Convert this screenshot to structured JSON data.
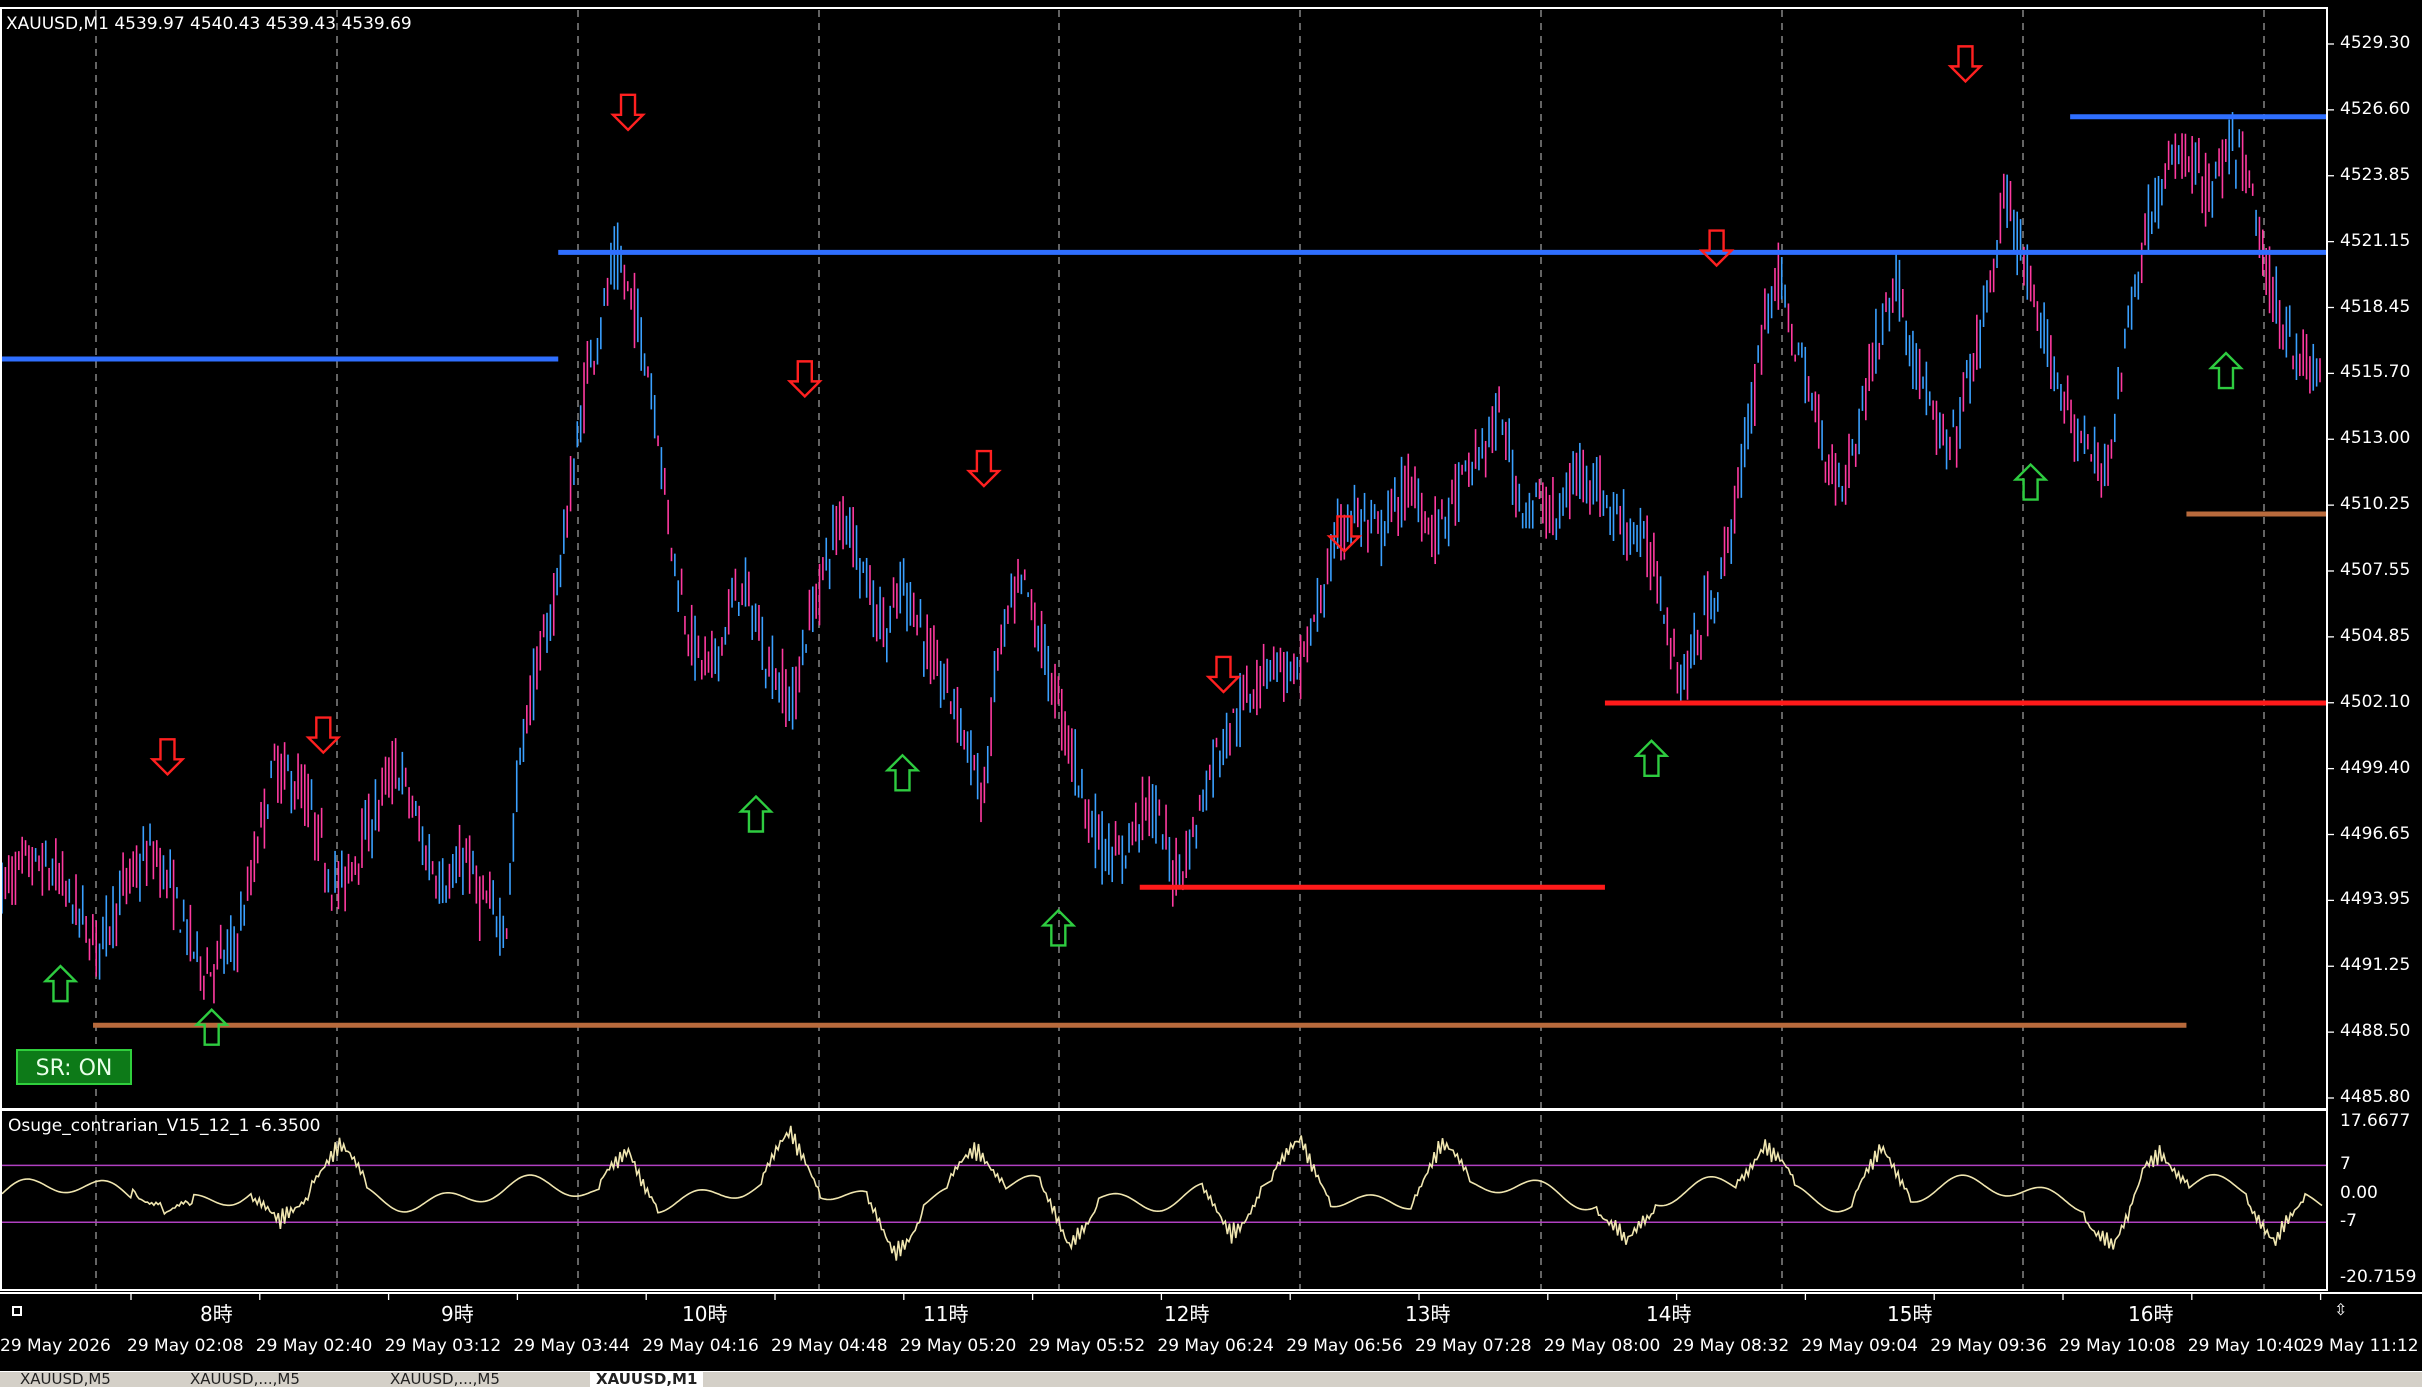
{
  "symbol_info": "XAUUSD,M1  4539.97 4540.43 4539.43 4539.69",
  "indicator_info": "Osuge_contrarian_V15_12_1 -6.3500",
  "sr_button": "SR: ON",
  "price_axis": {
    "ticks": [
      "4529.30",
      "4526.60",
      "4523.85",
      "4521.15",
      "4518.45",
      "4515.70",
      "4513.00",
      "4510.25",
      "4507.55",
      "4504.85",
      "4502.10",
      "4499.40",
      "4496.65",
      "4493.95",
      "4491.25",
      "4488.50",
      "4485.80"
    ],
    "min": 4485.8,
    "max": 4529.3
  },
  "indicator_axis": {
    "ticks": [
      "17.6677",
      "7",
      "0.00",
      "-7",
      "-20.7159"
    ],
    "levels": [
      7,
      -7
    ],
    "min": -20.7159,
    "max": 17.6677
  },
  "timeframe_labels": [
    "8時",
    "9時",
    "10時",
    "11時",
    "12時",
    "13時",
    "14時",
    "15時",
    "16時"
  ],
  "time_labels": [
    "29 May 2026",
    "29 May 02:08",
    "29 May 02:40",
    "29 May 03:12",
    "29 May 03:44",
    "29 May 04:16",
    "29 May 04:48",
    "29 May 05:20",
    "29 May 05:52",
    "29 May 06:24",
    "29 May 06:56",
    "29 May 07:28",
    "29 May 08:00",
    "29 May 08:32",
    "29 May 09:04",
    "29 May 09:36",
    "29 May 10:08",
    "29 May 10:40",
    "29 May 11:12"
  ],
  "tabs": [
    "XAUUSD,M5",
    "XAUUSD,...,M5",
    "XAUUSD,...,M5",
    "XAUUSD,M1"
  ],
  "colors": {
    "background": "#000000",
    "bull_candle": "#3aa0ff",
    "bear_candle": "#ff3aa0",
    "resistance_blue": "#2f6fff",
    "support_red": "#ff1a1a",
    "level_brown": "#b86a3c",
    "buy_arrow": "#2ecc40",
    "sell_arrow": "#ff2020",
    "indicator_line": "#f0e6b0",
    "indicator_level": "#b040c0"
  },
  "chart_data": {
    "type": "candlestick",
    "symbol": "XAUUSD",
    "timeframe": "M1",
    "ohlc_last": {
      "open": 4539.97,
      "high": 4540.43,
      "low": 4539.43,
      "close": 4539.69
    },
    "ylim": [
      4485.8,
      4529.3
    ],
    "price_path": [
      [
        0,
        4494.5
      ],
      [
        2,
        4495.5
      ],
      [
        4,
        4495
      ],
      [
        5,
        4494
      ],
      [
        6,
        4493
      ],
      [
        7,
        4492
      ],
      [
        9,
        4494.5
      ],
      [
        11,
        4496
      ],
      [
        12,
        4495
      ],
      [
        13,
        4493.5
      ],
      [
        14,
        4492
      ],
      [
        15,
        4491
      ],
      [
        17,
        4492
      ],
      [
        18,
        4494
      ],
      [
        19,
        4497
      ],
      [
        20,
        4499.5
      ],
      [
        21,
        4499
      ],
      [
        22,
        4498.5
      ],
      [
        23,
        4497
      ],
      [
        24,
        4495
      ],
      [
        25,
        4494.5
      ],
      [
        26,
        4496
      ],
      [
        27,
        4497
      ],
      [
        28,
        4498.5
      ],
      [
        29,
        4499.5
      ],
      [
        30,
        4498
      ],
      [
        31,
        4496
      ],
      [
        32,
        4495
      ],
      [
        33,
        4494.5
      ],
      [
        34,
        4496
      ],
      [
        35,
        4494
      ],
      [
        36,
        4493.5
      ],
      [
        37,
        4493
      ],
      [
        38,
        4500
      ],
      [
        39,
        4503
      ],
      [
        40,
        4505
      ],
      [
        41,
        4508
      ],
      [
        42,
        4512
      ],
      [
        43,
        4516
      ],
      [
        44,
        4518
      ],
      [
        45,
        4520.5
      ],
      [
        46,
        4519
      ],
      [
        47,
        4517
      ],
      [
        48,
        4514
      ],
      [
        49,
        4509
      ],
      [
        50,
        4506
      ],
      [
        51,
        4504
      ],
      [
        52,
        4503.5
      ],
      [
        53,
        4505
      ],
      [
        54,
        4507
      ],
      [
        55,
        4506
      ],
      [
        56,
        4504
      ],
      [
        57,
        4503
      ],
      [
        58,
        4502
      ],
      [
        59,
        4505
      ],
      [
        60,
        4507
      ],
      [
        61,
        4509
      ],
      [
        62,
        4510
      ],
      [
        63,
        4508
      ],
      [
        64,
        4506
      ],
      [
        65,
        4505
      ],
      [
        66,
        4507
      ],
      [
        67,
        4506
      ],
      [
        68,
        4504
      ],
      [
        69,
        4503
      ],
      [
        70,
        4502
      ],
      [
        71,
        4500
      ],
      [
        72,
        4498
      ],
      [
        73,
        4504
      ],
      [
        74,
        4506
      ],
      [
        75,
        4507
      ],
      [
        76,
        4505
      ],
      [
        77,
        4503
      ],
      [
        78,
        4501
      ],
      [
        79,
        4499
      ],
      [
        80,
        4497
      ],
      [
        81,
        4496
      ],
      [
        82,
        4495.5
      ],
      [
        83,
        4497
      ],
      [
        84,
        4498
      ],
      [
        85,
        4497
      ],
      [
        86,
        4495
      ],
      [
        87,
        4496
      ],
      [
        88,
        4498
      ],
      [
        89,
        4500
      ],
      [
        90,
        4501
      ],
      [
        91,
        4502
      ],
      [
        92,
        4503
      ],
      [
        93,
        4504
      ],
      [
        94,
        4503.5
      ],
      [
        95,
        4503
      ],
      [
        96,
        4505
      ],
      [
        97,
        4507
      ],
      [
        98,
        4509
      ],
      [
        99,
        4510
      ],
      [
        100,
        4509.5
      ],
      [
        101,
        4509
      ],
      [
        102,
        4510
      ],
      [
        103,
        4511
      ],
      [
        104,
        4510.5
      ],
      [
        105,
        4509
      ],
      [
        106,
        4510
      ],
      [
        107,
        4511
      ],
      [
        108,
        4512
      ],
      [
        109,
        4513
      ],
      [
        110,
        4514
      ],
      [
        111,
        4511
      ],
      [
        112,
        4510
      ],
      [
        113,
        4510.5
      ],
      [
        114,
        4509.5
      ],
      [
        115,
        4511
      ],
      [
        116,
        4512
      ],
      [
        117,
        4511
      ],
      [
        118,
        4510
      ],
      [
        119,
        4509.5
      ],
      [
        120,
        4509
      ],
      [
        121,
        4508
      ],
      [
        122,
        4506
      ],
      [
        123,
        4503
      ],
      [
        124,
        4504
      ],
      [
        125,
        4506
      ],
      [
        126,
        4507
      ],
      [
        127,
        4510
      ],
      [
        128,
        4513
      ],
      [
        129,
        4517
      ],
      [
        130,
        4520
      ],
      [
        131,
        4518
      ],
      [
        132,
        4516
      ],
      [
        133,
        4514
      ],
      [
        134,
        4512
      ],
      [
        135,
        4511
      ],
      [
        136,
        4513
      ],
      [
        137,
        4516
      ],
      [
        138,
        4518
      ],
      [
        139,
        4519.5
      ],
      [
        140,
        4517
      ],
      [
        141,
        4515
      ],
      [
        142,
        4513
      ],
      [
        143,
        4512.5
      ],
      [
        144,
        4515
      ],
      [
        145,
        4517
      ],
      [
        146,
        4520
      ],
      [
        147,
        4523
      ],
      [
        148,
        4521
      ],
      [
        149,
        4518
      ],
      [
        150,
        4517
      ],
      [
        151,
        4515
      ],
      [
        152,
        4513.5
      ],
      [
        153,
        4512.5
      ],
      [
        154,
        4511.5
      ],
      [
        155,
        4514
      ],
      [
        156,
        4518
      ],
      [
        157,
        4521
      ],
      [
        158,
        4523
      ],
      [
        159,
        4524
      ],
      [
        160,
        4525
      ],
      [
        161,
        4524
      ],
      [
        162,
        4523
      ],
      [
        163,
        4524.5
      ],
      [
        164,
        4525
      ],
      [
        165,
        4523
      ],
      [
        166,
        4520
      ],
      [
        167,
        4518
      ],
      [
        168,
        4517
      ],
      [
        169,
        4516
      ],
      [
        170,
        4515.5
      ]
    ],
    "horizontal_levels": [
      {
        "price": 4516.3,
        "color": "resistance_blue",
        "from": 0,
        "to": 24
      },
      {
        "price": 4520.7,
        "color": "resistance_blue",
        "from": 24,
        "to": 100
      },
      {
        "price": 4526.3,
        "color": "resistance_blue",
        "from": 89,
        "to": 100
      },
      {
        "price": 4494.5,
        "color": "support_red",
        "from": 49,
        "to": 69
      },
      {
        "price": 4502.1,
        "color": "support_red",
        "from": 69,
        "to": 100
      },
      {
        "price": 4488.8,
        "color": "level_brown",
        "from": 4,
        "to": 94
      },
      {
        "price": 4509.9,
        "color": "level_brown",
        "from": 94,
        "to": 100
      }
    ],
    "signals": [
      {
        "type": "buy",
        "x": 2.6,
        "price": 4490.5
      },
      {
        "type": "buy",
        "x": 9.1,
        "price": 4488.7
      },
      {
        "type": "buy",
        "x": 32.5,
        "price": 4497.5
      },
      {
        "type": "buy",
        "x": 38.8,
        "price": 4499.2
      },
      {
        "type": "buy",
        "x": 45.5,
        "price": 4492.8
      },
      {
        "type": "buy",
        "x": 71,
        "price": 4499.8
      },
      {
        "type": "buy",
        "x": 87.3,
        "price": 4511.2
      },
      {
        "type": "buy",
        "x": 95.7,
        "price": 4515.8
      },
      {
        "type": "sell",
        "x": 7.2,
        "price": 4499.9
      },
      {
        "type": "sell",
        "x": 13.9,
        "price": 4500.8
      },
      {
        "type": "sell",
        "x": 27,
        "price": 4526.5
      },
      {
        "type": "sell",
        "x": 34.6,
        "price": 4515.5
      },
      {
        "type": "sell",
        "x": 42.3,
        "price": 4511.8
      },
      {
        "type": "sell",
        "x": 52.6,
        "price": 4503.3
      },
      {
        "type": "sell",
        "x": 57.8,
        "price": 4509.1
      },
      {
        "type": "sell",
        "x": 73.8,
        "price": 4520.9
      },
      {
        "type": "sell",
        "x": 84.5,
        "price": 4528.5
      }
    ]
  }
}
